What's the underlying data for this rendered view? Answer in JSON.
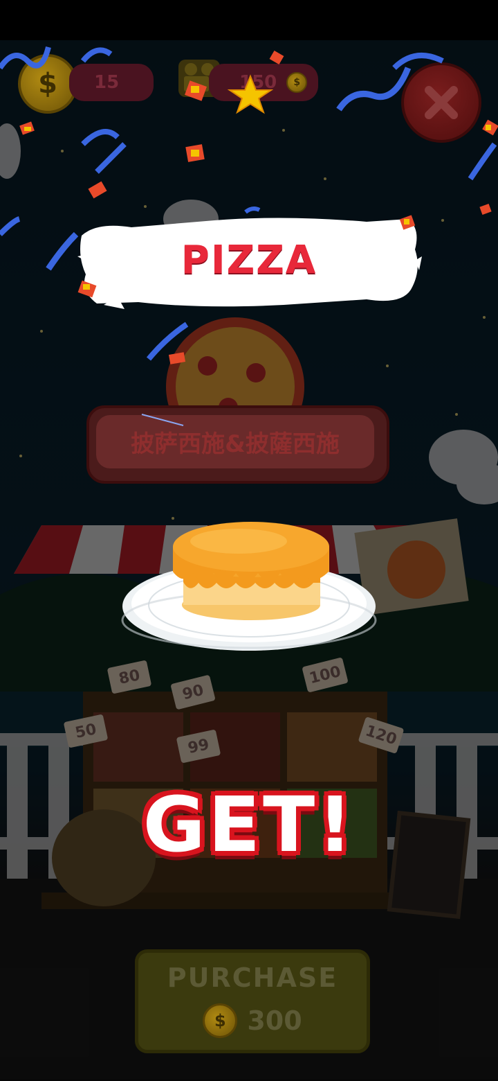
{
  "hud": {
    "coins": "15",
    "video_reward": "150"
  },
  "reward": {
    "title": "PIZZA",
    "shop_sign": "披萨西施&披薩西施",
    "get_label": "GET!"
  },
  "price_tags": [
    "80",
    "90",
    "100",
    "50",
    "99",
    "120"
  ],
  "purchase": {
    "label": "PURCHASE",
    "price": "300"
  },
  "colors": {
    "accent_red": "#e8283a",
    "banner_white": "#ffffff",
    "gold": "#f5b800",
    "cake_orange": "#f39a1e"
  }
}
